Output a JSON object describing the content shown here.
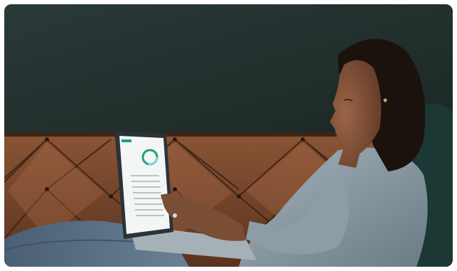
{
  "image": {
    "subject": "woman-using-laptop-on-couch",
    "colors": {
      "wall": "#243331",
      "wall_dark": "#1a2624",
      "leather": "#7a4a30",
      "leather_dark": "#4e2b1a",
      "leather_light": "#9a5f3e",
      "sweater": "#8a9aa3",
      "sweater_dark": "#5f6f78",
      "jeans": "#5b7186",
      "skin": "#7a4d35",
      "hair": "#1c120d",
      "laptop_body": "#9aa4ab",
      "screen_bg": "#f3f6f5",
      "screen_accent": "#1aa37a",
      "pillow": "#1c3a36"
    }
  }
}
